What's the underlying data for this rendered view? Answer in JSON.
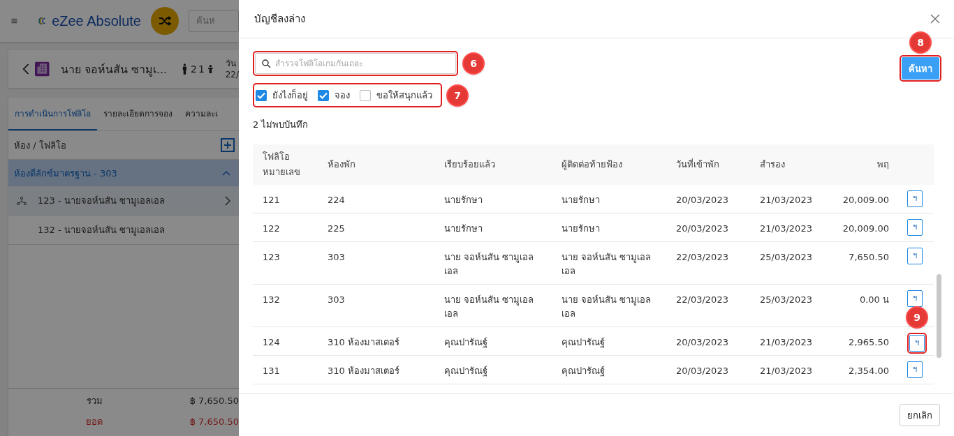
{
  "app_header": {
    "logo_text": "eZee Absolute",
    "search_placeholder": "ค้นห"
  },
  "reservation": {
    "guest_name": "นาย จอห์นสัน ซามูเ...",
    "adults": "2",
    "children": "1",
    "date_label": "วัน",
    "date": "22/"
  },
  "tabs": [
    {
      "label": "การดำเนินการโฟลิโอ",
      "selected": true
    },
    {
      "label": "รายละเอียดการจอง",
      "selected": false
    },
    {
      "label": "ความละเ",
      "selected": false
    }
  ],
  "folio_list": {
    "heading": "ห้อง / โฟลิโอ",
    "groups": [
      {
        "label": "ห้องดีลักซ์มาตรฐาน - 303",
        "expanded": true,
        "children": [
          {
            "label": "123 - นายจอห์นสัน ซามูเอลเอล",
            "kind": "master",
            "selected": true
          },
          {
            "label": "132 - นายจอห์นสัน ซามูเอลเอล",
            "kind": "sub",
            "selected": false
          }
        ]
      }
    ]
  },
  "totals": [
    {
      "label": "รวม",
      "amount": "฿ 7,650.50",
      "kind": "total"
    },
    {
      "label": "ยอด",
      "amount": "฿ 7,650.50",
      "kind": "balance"
    }
  ],
  "dialog": {
    "title": "บัญชีลงล่าง",
    "search": {
      "placeholder": "สำรวจโฟลิโอเกมกันเถอะ",
      "callout": "6"
    },
    "filters": {
      "callout": "7",
      "items": [
        {
          "label": "ยังไงก็อยู่",
          "checked": true
        },
        {
          "label": "จอง",
          "checked": true
        },
        {
          "label": "ขอให้สนุกแล้ว",
          "checked": false
        }
      ]
    },
    "search_button": {
      "label": "ค้นหา",
      "callout": "8"
    },
    "result_count": "2 ไม่พบบันทึก",
    "table": {
      "columns": [
        "โฟลิโอ หมายเลข",
        "ห้องพัก",
        "เรียบร้อยแล้ว",
        "ผู้ติดต่อท้ายฟ้อง",
        "วันที่เข้าพัก",
        "สำรอง",
        "พฤ"
      ],
      "rows": [
        {
          "cells": [
            "121",
            "224",
            "นายรักษา",
            "นายรักษา",
            "20/03/2023",
            "21/03/2023",
            "20,009.00"
          ],
          "action": "ฯ"
        },
        {
          "cells": [
            "122",
            "225",
            "นายรักษา",
            "นายรักษา",
            "20/03/2023",
            "21/03/2023",
            "20,009.00"
          ],
          "action": "ฯ"
        },
        {
          "cells": [
            "123",
            "303",
            "นาย จอห์นสัน ซามูเอลเอล",
            "นาย จอห์นสัน ซามูเอลเอล",
            "22/03/2023",
            "25/03/2023",
            "7,650.50"
          ],
          "action": "ฯ"
        },
        {
          "cells": [
            "132",
            "303",
            "นาย จอห์นสัน ซามูเอลเอล",
            "นาย จอห์นสัน ซามูเอลเอล",
            "22/03/2023",
            "25/03/2023",
            "0.00 น"
          ],
          "action": "ฯ"
        },
        {
          "cells": [
            "124",
            "310 ห้องมาสเตอร์",
            "คุณปารัณฐ์",
            "คุณปารัณฐ์",
            "20/03/2023",
            "21/03/2023",
            "2,965.50"
          ],
          "action": "ฯ",
          "callout": "9"
        },
        {
          "cells": [
            "131",
            "310 ห้องมาสเตอร์",
            "คุณปารัณฐ์",
            "คุณปารัณฐ์",
            "20/03/2023",
            "21/03/2023",
            "2,354.00"
          ],
          "action": "ฯ"
        }
      ]
    },
    "cancel_button": "ยกเลิก"
  }
}
